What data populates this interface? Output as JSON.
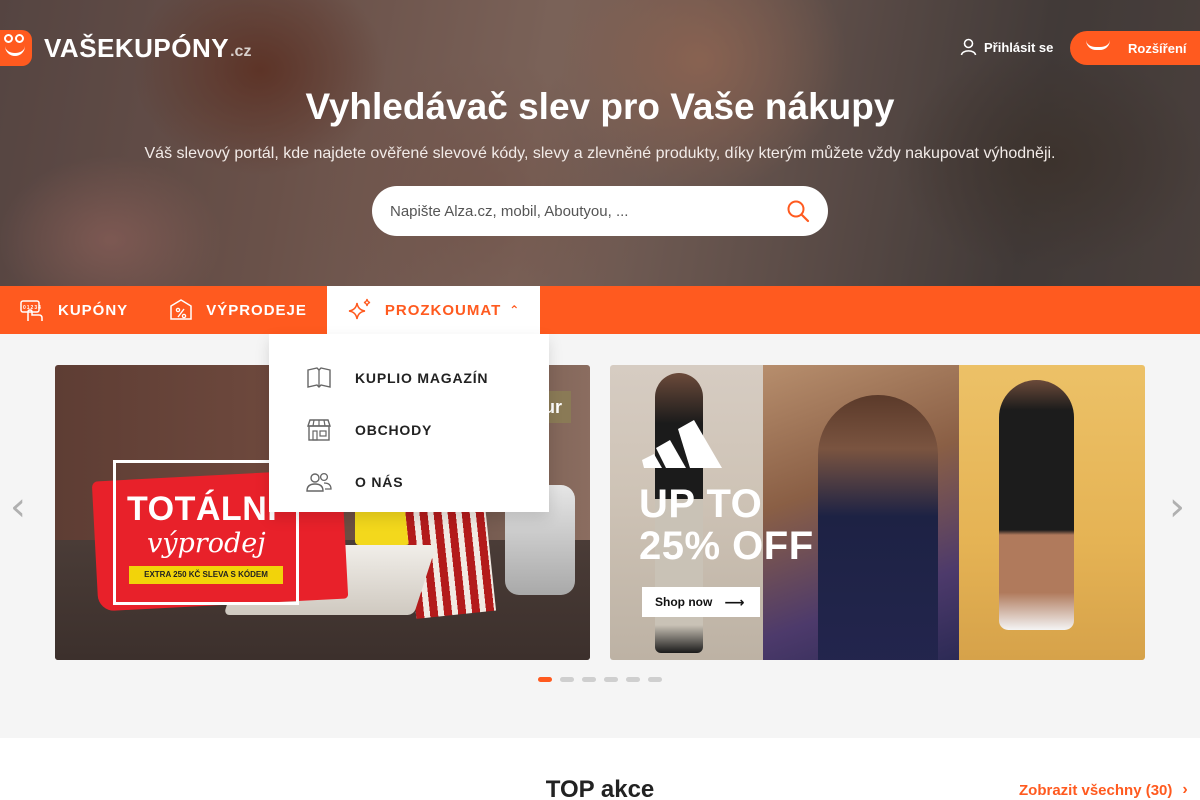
{
  "brand": {
    "name": "VAŠEKUPÓNY",
    "tld": ".cz"
  },
  "header": {
    "login_label": "Přihlásit se",
    "extension_label": "Rozšíření"
  },
  "hero": {
    "title": "Vyhledávač slev pro Vaše nákupy",
    "subtitle": "Váš slevový portál, kde najdete ověřené slevové kódy, slevy a zlevněné produkty, díky kterým můžete vždy nakupovat výhodněji.",
    "search_placeholder": "Napište Alza.cz, mobil, Aboutyou, ..."
  },
  "nav": {
    "items": [
      {
        "label": "KUPÓNY",
        "icon": "coupon-hand-icon"
      },
      {
        "label": "VÝPRODEJE",
        "icon": "percent-tag-icon"
      },
      {
        "label": "PROZKOUMAT",
        "icon": "sparkles-icon",
        "active": true
      }
    ]
  },
  "dropdown": {
    "items": [
      {
        "label": "KUPLIO MAGAZÍN",
        "icon": "book-icon"
      },
      {
        "label": "OBCHODY",
        "icon": "store-icon"
      },
      {
        "label": "O NÁS",
        "icon": "users-icon"
      }
    ]
  },
  "carousel": {
    "slide1": {
      "headline": "TOTÁLNÍ",
      "script": "výprodej",
      "strip": "EXTRA 250 KČ SLEVA S KÓDEM",
      "tag": "ur"
    },
    "slide2": {
      "promo_line1": "UP TO",
      "promo_line2": "25% OFF",
      "cta": "Shop now"
    },
    "dots_total": 6,
    "active_dot": 0
  },
  "section": {
    "title": "TOP akce",
    "show_all": "Zobrazit všechny (30)"
  },
  "colors": {
    "accent": "#ff5a1f",
    "nav_text": "#ffffff"
  }
}
